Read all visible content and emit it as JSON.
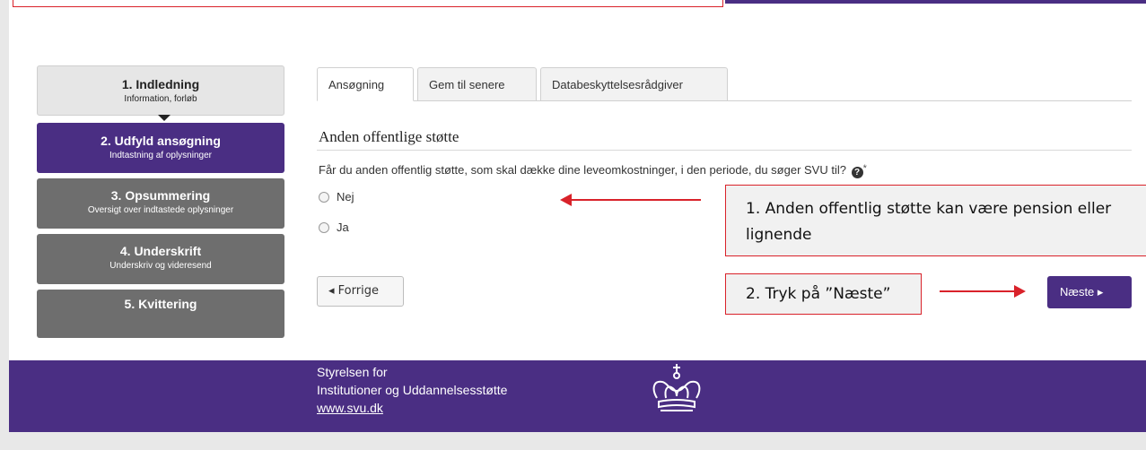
{
  "steps": [
    {
      "title": "1. Indledning",
      "sub": "Information, forløb"
    },
    {
      "title": "2. Udfyld ansøgning",
      "sub": "Indtastning af oplysninger"
    },
    {
      "title": "3. Opsummering",
      "sub": "Oversigt over indtastede oplysninger"
    },
    {
      "title": "4. Underskrift",
      "sub": "Underskriv og videresend"
    },
    {
      "title": "5. Kvittering",
      "sub": ""
    }
  ],
  "tabs": [
    "Ansøgning",
    "Gem til senere",
    "Databeskyttelsesrådgiver"
  ],
  "section_title": "Anden offentlige støtte",
  "question": "Får du anden offentlig støtte, som skal dække dine leveomkostninger, i den periode, du søger SVU til?",
  "help_icon_glyph": "?",
  "required_marker": "*",
  "options": [
    "Nej",
    "Ja"
  ],
  "annotations": {
    "note1": "1. Anden offentlig støtte kan være pension eller lignende",
    "note2": "2. Tryk på ”Næste”"
  },
  "buttons": {
    "prev": "◂ Forrige",
    "next": "Næste ▸"
  },
  "footer": {
    "line1": "Styrelsen for",
    "line2": "Institutioner og Uddannelsesstøtte",
    "link": "www.svu.dk"
  },
  "colors": {
    "brand": "#4a2e83",
    "annotation": "#d9222a",
    "step_inactive": "#6e6e6e"
  }
}
